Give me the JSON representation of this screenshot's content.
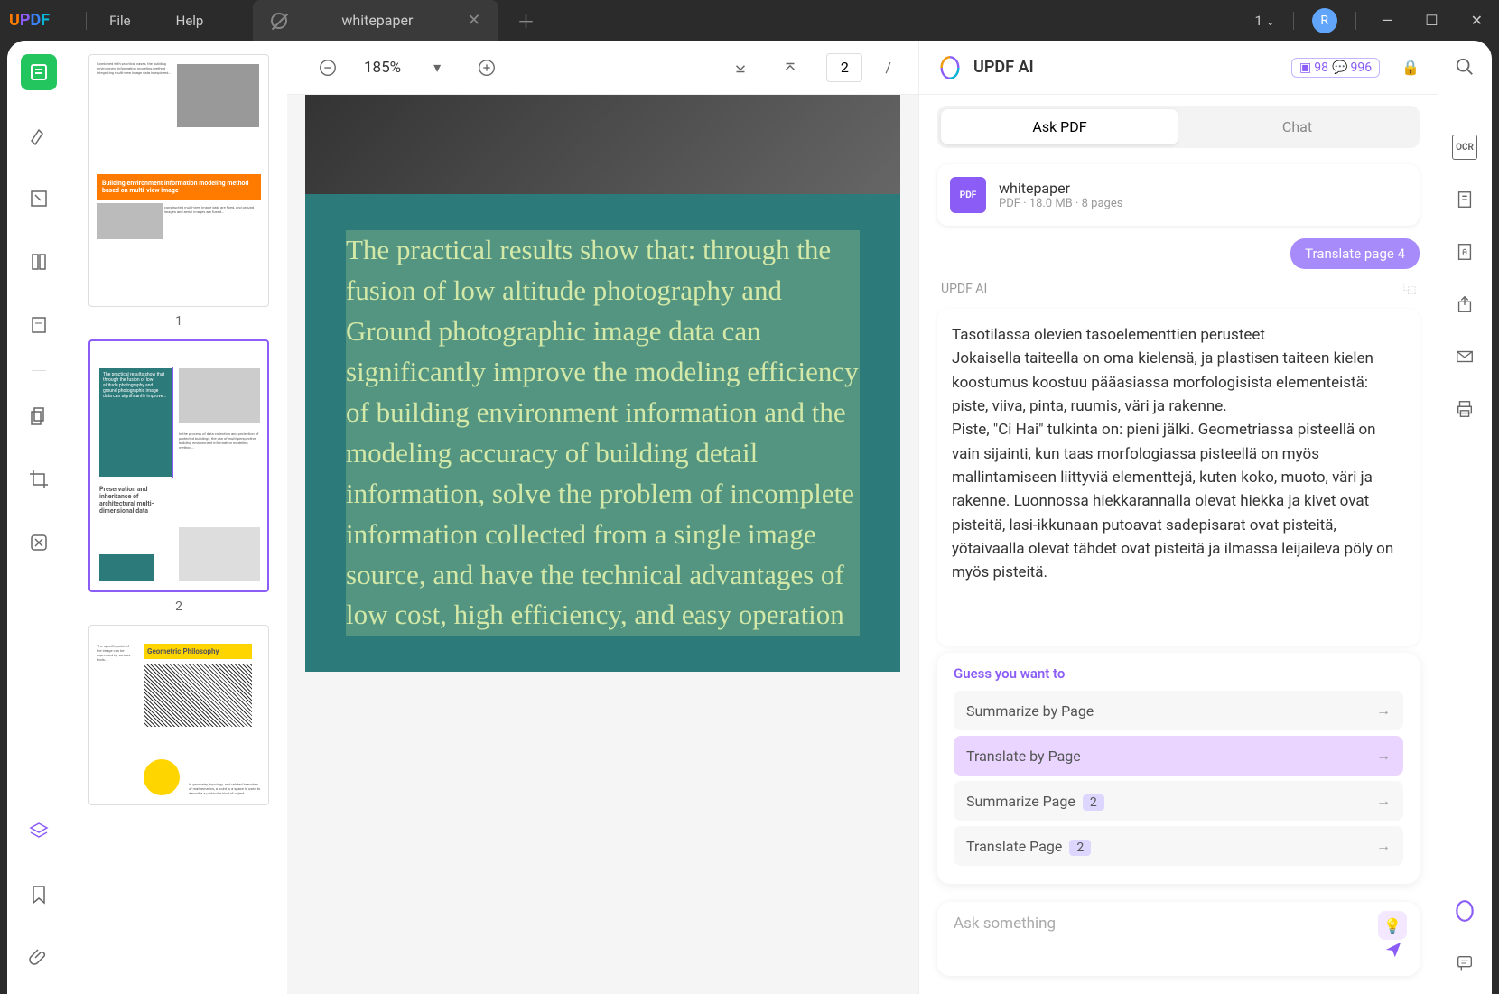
{
  "app": {
    "logo": "UPDF",
    "menus": [
      "File",
      "Help"
    ]
  },
  "tab": {
    "title": "whitepaper"
  },
  "titlebar": {
    "count": "1",
    "avatar_letter": "R"
  },
  "toolbar": {
    "zoom": "185%",
    "current_page": "2",
    "page_sep": "/"
  },
  "thumbs": [
    {
      "num": "1",
      "title": "Building environment information modeling method based on multi-view image"
    },
    {
      "num": "2",
      "title": "Preservation and inheritance of architectural multi-dimensional data"
    },
    {
      "num": "3",
      "title": "Geometric Philosophy"
    }
  ],
  "doc": {
    "text": "The practical results show that: through the fusion of low altitude photography and Ground photographic image data can significantly improve the modeling efficiency of building environment information and the modeling accuracy of building detail information, solve the problem of incomplete information collected from a single image source, and have the technical advantages of low cost, high efficiency, and easy operation"
  },
  "ai": {
    "title": "UPDF AI",
    "badge1": "98",
    "badge2": "996",
    "tabs": {
      "ask": "Ask PDF",
      "chat": "Chat"
    },
    "file": {
      "name": "whitepaper",
      "meta": "PDF · 18.0 MB · 8 pages",
      "icon_label": "PDF"
    },
    "translate_badge": "Translate page 4",
    "label": "UPDF AI",
    "response": "Tasotilassa olevien tasoelementtien perusteet\nJokaisella taiteella on oma kielensä, ja plastisen taiteen kielen koostumus koostuu pääasiassa morfologisista elementeistä: piste, viiva, pinta, ruumis, väri ja rakenne.\nPiste, \"Ci Hai\" tulkinta on: pieni jälki. Geometriassa pisteellä on vain sijainti, kun taas morfologiassa pisteellä on myös mallintamiseen liittyviä elementtejä, kuten koko, muoto, väri ja rakenne. Luonnossa hiekkarannalla olevat hiekka ja kivet ovat pisteitä, lasi-ikkunaan putoavat sadepisarat ovat pisteitä, yötaivaalla olevat tähdet ovat pisteitä ja ilmassa leijaileva pöly on myös pisteitä.",
    "suggest_title": "Guess you want to",
    "suggestions": [
      {
        "label": "Summarize by Page",
        "badge": ""
      },
      {
        "label": "Translate by Page",
        "badge": "",
        "highlight": true
      },
      {
        "label": "Summarize Page",
        "badge": "2"
      },
      {
        "label": "Translate Page",
        "badge": "2"
      }
    ],
    "input_placeholder": "Ask something"
  }
}
